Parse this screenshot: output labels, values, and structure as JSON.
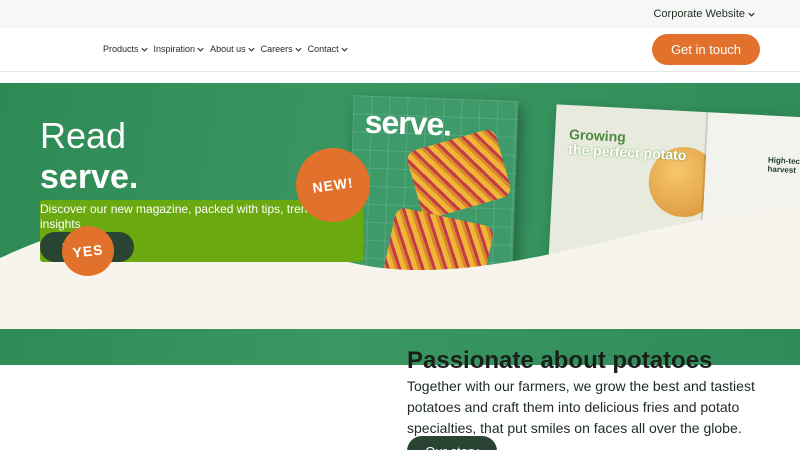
{
  "topbar": {
    "corporate_label": "Corporate Website"
  },
  "nav": {
    "items": [
      {
        "label": "Products"
      },
      {
        "label": "Inspiration"
      },
      {
        "label": "About us"
      },
      {
        "label": "Careers"
      },
      {
        "label": "Contact"
      }
    ],
    "cta_label": "Get in touch"
  },
  "hero": {
    "read": "Read",
    "serve": "serve.",
    "description": "Discover our new magazine, packed with tips, trends and insights",
    "button_label": "Discover",
    "badge_new": "NEW!",
    "badge_yes": "YES",
    "magazine_cover_title": "serve.",
    "magazine_spread_heading_top": "Growing",
    "magazine_spread_heading_bottom": "the perfect potato",
    "magazine_spread_side": "High-tech harvest",
    "colors": {
      "hero_green": "#2e8a55",
      "accent_orange": "#e2722b",
      "lime": "#6aa90f",
      "dark_green": "#2a4434"
    }
  },
  "section": {
    "title": "Passionate about potatoes",
    "body": "Together with our farmers, we grow the best and tastiest potatoes and craft them into delicious fries and potato specialties, that put smiles on faces all over the globe.",
    "button_label": "Our story"
  }
}
